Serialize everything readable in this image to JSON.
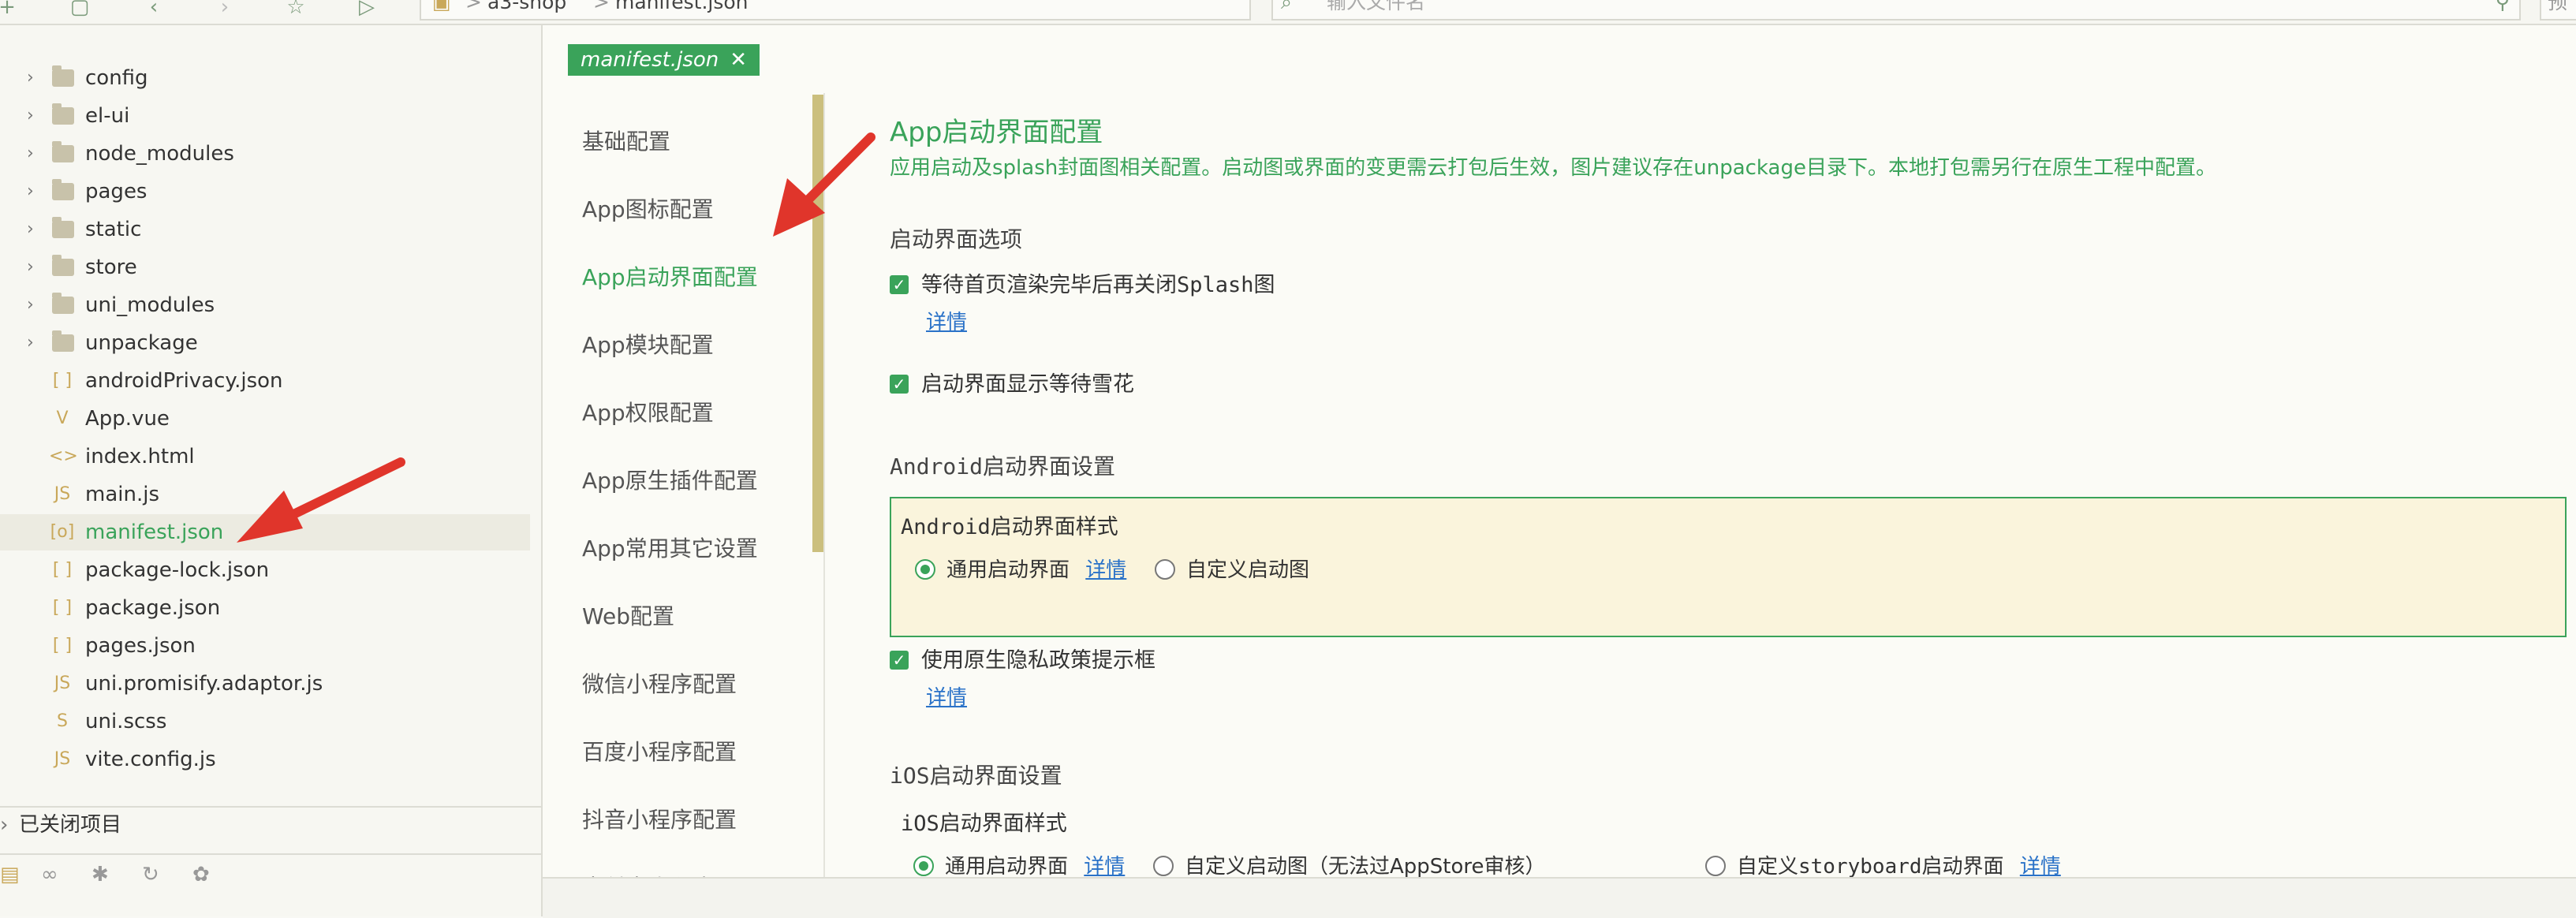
{
  "toolbar": {
    "breadcrumb": [
      "a3-shop",
      "manifest.json"
    ],
    "breadcrumb_sep": ">",
    "search_placeholder": "输入文件名",
    "right_button": "预"
  },
  "sidebar": {
    "items": [
      {
        "label": "config",
        "type": "folder"
      },
      {
        "label": "el-ui",
        "type": "folder"
      },
      {
        "label": "node_modules",
        "type": "folder"
      },
      {
        "label": "pages",
        "type": "folder"
      },
      {
        "label": "static",
        "type": "folder"
      },
      {
        "label": "store",
        "type": "folder"
      },
      {
        "label": "uni_modules",
        "type": "folder"
      },
      {
        "label": "unpackage",
        "type": "folder"
      },
      {
        "label": "androidPrivacy.json",
        "type": "json",
        "glyph": "[ ]"
      },
      {
        "label": "App.vue",
        "type": "vue",
        "glyph": "V"
      },
      {
        "label": "index.html",
        "type": "html",
        "glyph": "<>"
      },
      {
        "label": "main.js",
        "type": "js",
        "glyph": "JS"
      },
      {
        "label": "manifest.json",
        "type": "manifest",
        "glyph": "[o]",
        "selected": true
      },
      {
        "label": "package-lock.json",
        "type": "json",
        "glyph": "[ ]"
      },
      {
        "label": "package.json",
        "type": "json",
        "glyph": "[ ]"
      },
      {
        "label": "pages.json",
        "type": "json",
        "glyph": "[ ]"
      },
      {
        "label": "uni.promisify.adaptor.js",
        "type": "js",
        "glyph": "JS"
      },
      {
        "label": "uni.scss",
        "type": "scss",
        "glyph": "S"
      },
      {
        "label": "vite.config.js",
        "type": "js",
        "glyph": "JS"
      }
    ],
    "closed_projects": "已关闭项目"
  },
  "editor": {
    "tab_label": "manifest.json",
    "nav": [
      "基础配置",
      "App图标配置",
      "App启动界面配置",
      "App模块配置",
      "App权限配置",
      "App原生插件配置",
      "App常用其它设置",
      "Web配置",
      "微信小程序配置",
      "百度小程序配置",
      "抖音小程序配置",
      "支付宝小程序配置"
    ],
    "active_nav": 2,
    "section_title": "App启动界面配置",
    "section_desc": "应用启动及splash封面图相关配置。启动图或界面的变更需云打包后生效，图片建议存在unpackage目录下。本地打包需另行在原生工程中配置。",
    "splash_options_title": "启动界面选项",
    "wait_render_label": "等待首页渲染完毕后再关闭Splash图",
    "detail_link": "详情",
    "show_snow_label": "启动界面显示等待雪花",
    "android_settings_title": "Android启动界面设置",
    "android_style_title": "Android启动界面样式",
    "android_radio_general": "通用启动界面",
    "android_radio_custom": "自定义启动图",
    "privacy_label": "使用原生隐私政策提示框",
    "ios_settings_title": "iOS启动界面设置",
    "ios_style_title": "iOS启动界面样式",
    "ios_radio_general": "通用启动界面",
    "ios_radio_custom": "自定义启动图（无法过AppStore审核）",
    "ios_radio_storyboard": "自定义storyboard启动界面"
  },
  "colors": {
    "accent": "#3aa35a",
    "link": "#2a72c8",
    "arrow": "#e0352b"
  }
}
